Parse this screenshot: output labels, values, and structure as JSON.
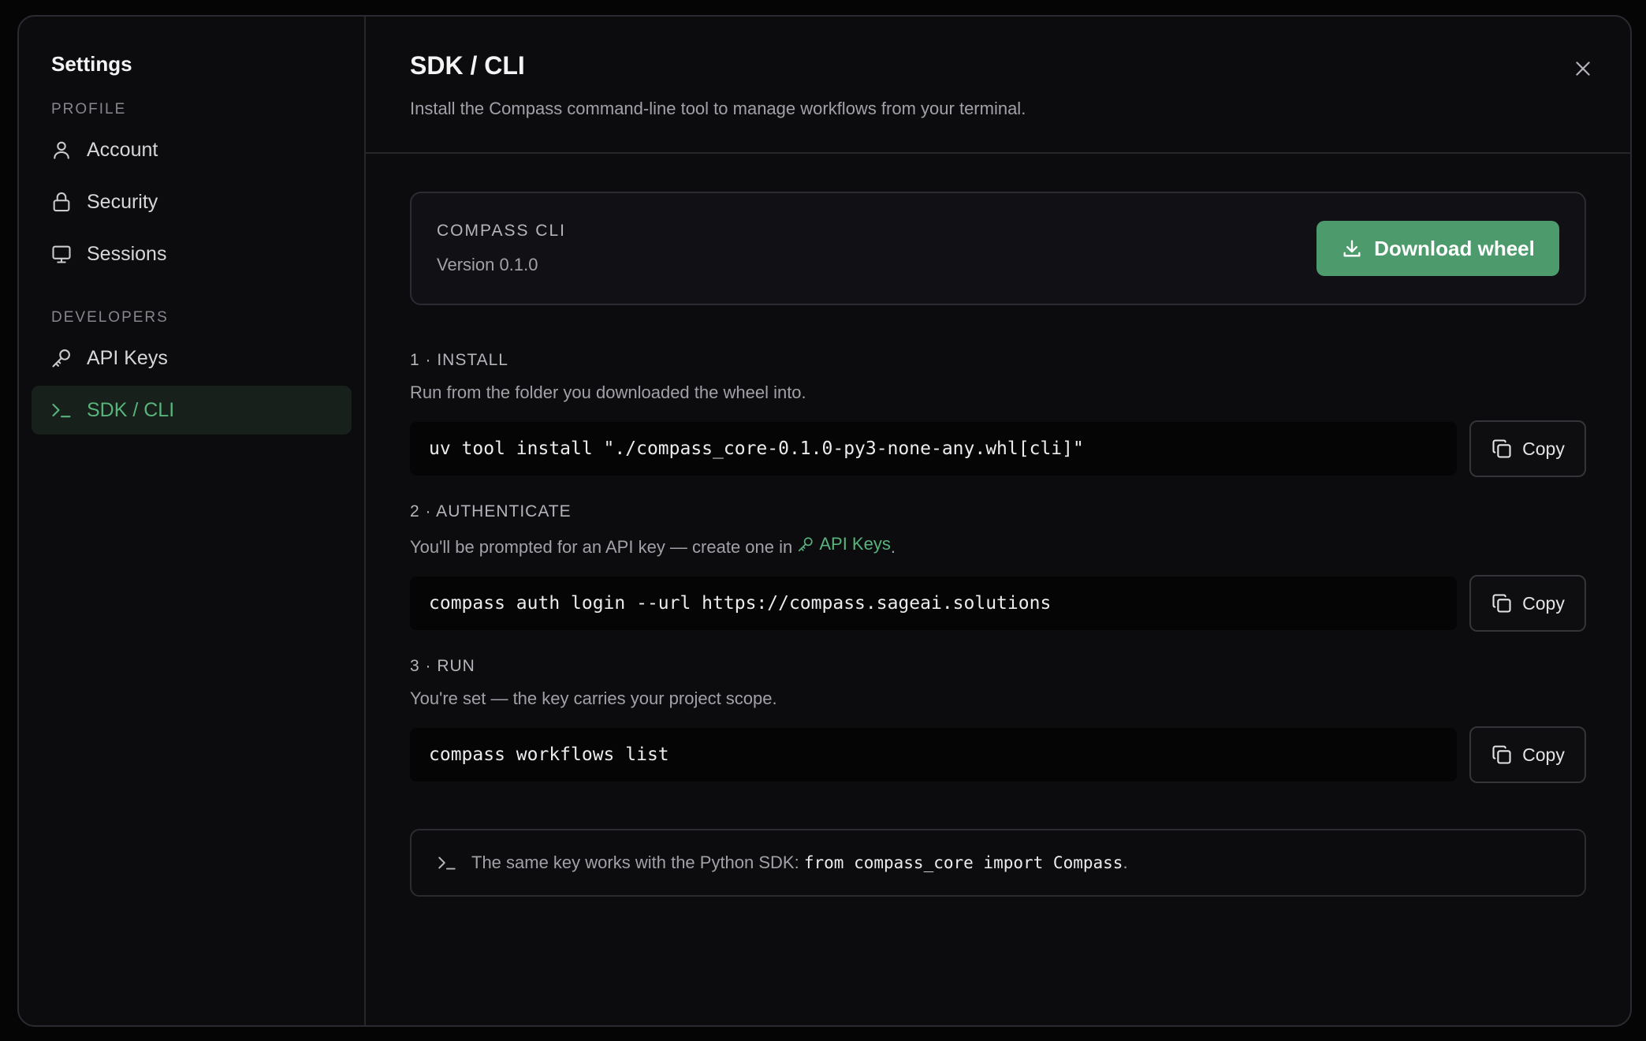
{
  "sidebar": {
    "title": "Settings",
    "sections": [
      {
        "label": "PROFILE",
        "items": [
          {
            "label": "Account",
            "icon": "user-icon"
          },
          {
            "label": "Security",
            "icon": "lock-icon"
          },
          {
            "label": "Sessions",
            "icon": "monitor-icon"
          }
        ]
      },
      {
        "label": "DEVELOPERS",
        "items": [
          {
            "label": "API Keys",
            "icon": "key-icon"
          },
          {
            "label": "SDK / CLI",
            "icon": "terminal-icon",
            "active": true
          }
        ]
      }
    ]
  },
  "header": {
    "title": "SDK / CLI",
    "subtitle": "Install the Compass command-line tool to manage workflows from your terminal."
  },
  "cli_card": {
    "name": "COMPASS CLI",
    "version": "Version 0.1.0",
    "download_label": "Download wheel"
  },
  "steps": [
    {
      "label": "1 · INSTALL",
      "description": "Run from the folder you downloaded the wheel into.",
      "command": "uv tool install \"./compass_core-0.1.0-py3-none-any.whl[cli]\"",
      "copy_label": "Copy"
    },
    {
      "label": "2 · AUTHENTICATE",
      "description_prefix": "You'll be prompted for an API key — create one in ",
      "link_label": "API Keys",
      "description_suffix": ".",
      "command": "compass auth login --url https://compass.sageai.solutions",
      "copy_label": "Copy"
    },
    {
      "label": "3 · RUN",
      "description": "You're set — the key carries your project scope.",
      "command": "compass workflows list",
      "copy_label": "Copy"
    }
  ],
  "note": {
    "prefix": "The same key works with the Python SDK: ",
    "code": "from compass_core import Compass",
    "suffix": "."
  },
  "colors": {
    "accent": "#58b37c",
    "button_green": "#4d9a6c",
    "background": "#0c0c0f",
    "active_nav_bg": "#17201b"
  }
}
